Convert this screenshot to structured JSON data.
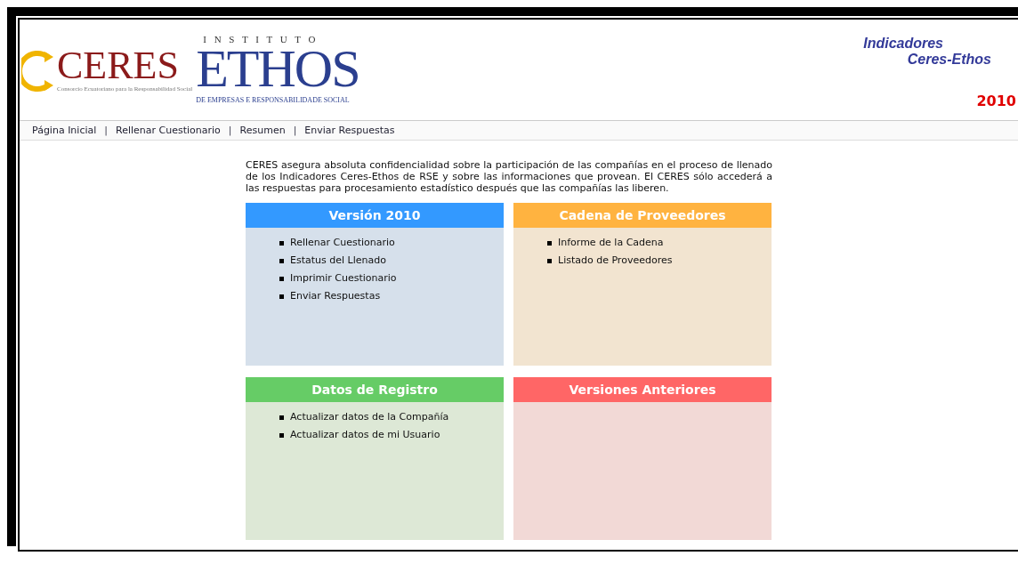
{
  "header": {
    "logo": {
      "instituto": "I N S T I T U T O",
      "ceres": "CERES",
      "ethos": "ETHOS",
      "ceres_tagline": "Consorcio Ecuatoriano para la Responsabilidad Social",
      "ethos_tagline": "DE EMPRESAS E RESPONSABILIDADE SOCIAL"
    },
    "title_line_1": "Indicadores",
    "title_line_2": "Ceres-Ethos",
    "year": "2010"
  },
  "nav": {
    "items": [
      "Página Inicial",
      "Rellenar Cuestionario",
      "Resumen",
      "Enviar Respuestas"
    ],
    "separator": "|"
  },
  "intro": "CERES asegura absoluta confidencialidad sobre la participación de las compañías en el proceso de llenado de los Indicadores Ceres-Ethos de RSE y sobre las informaciones que provean. El CERES sólo accederá a las respuestas para procesamiento estadístico después que las compañías las liberen.",
  "panels": [
    {
      "title": "Versión 2010",
      "color": "#3399ff",
      "links": [
        "Rellenar Cuestionario",
        "Estatus del Llenado",
        "Imprimir Cuestionario",
        "Enviar Respuestas"
      ]
    },
    {
      "title": "Cadena de Proveedores",
      "color": "#ffb340",
      "links": [
        "Informe de la Cadena",
        "Listado de Proveedores"
      ]
    },
    {
      "title": "Datos de Registro",
      "color": "#66cc66",
      "links": [
        "Actualizar datos de la Compañía",
        "Actualizar datos de mi Usuario"
      ]
    },
    {
      "title": "Versiones Anteriores",
      "color": "#ff6666"
    }
  ]
}
